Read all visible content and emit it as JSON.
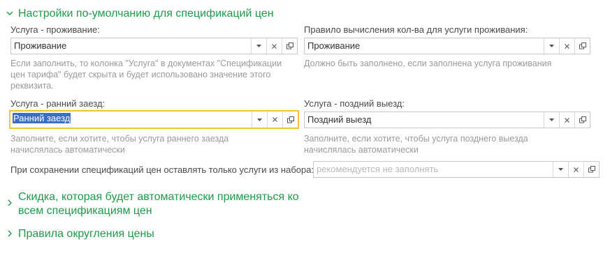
{
  "groups": {
    "defaults_title": "Настройки по-умолчанию для спецификаций цен",
    "discount_title": "Скидка, которая будет автоматически применяться ко всем спецификациям цен",
    "rounding_title": "Правила округления цены"
  },
  "fields": {
    "accommodation": {
      "label": "Услуга - проживание:",
      "value": "Проживание",
      "hint": "Если заполнить, то колонка \"Услуга\" в документах \"Спецификации цен тарифа\" будет скрыта и будет использовано значение этого реквизита."
    },
    "quantity_rule": {
      "label": "Правило вычисления кол-ва для услуги проживания:",
      "value": "Проживание",
      "hint": "Должно быть заполнено, если заполнена услуга проживания"
    },
    "early_checkin": {
      "label": "Услуга - ранний заезд:",
      "value": "Ранний заезд",
      "hint": "Заполните, если хотите, чтобы услуга раннего заезда начислялась автоматически"
    },
    "late_checkout": {
      "label": "Услуга - поздний выезд:",
      "value": "Поздний выезд",
      "hint": "Заполните, если хотите, чтобы услуга позднего выезда начислялась автоматически"
    },
    "service_set": {
      "label": "При сохранении спецификаций цен оставлять только услуги из набора:",
      "placeholder": "рекомендуется не заполнять"
    }
  },
  "icons": {
    "dropdown": "triangle-down-icon",
    "clear": "x-icon",
    "open": "open-form-icon",
    "expanded": "chevron-down-icon",
    "collapsed": "chevron-right-icon"
  },
  "colors": {
    "group_title": "#1f9a4a",
    "focus_border": "#f3c22f",
    "selection": "#3b6fc4",
    "hint": "#9a9a9a"
  }
}
